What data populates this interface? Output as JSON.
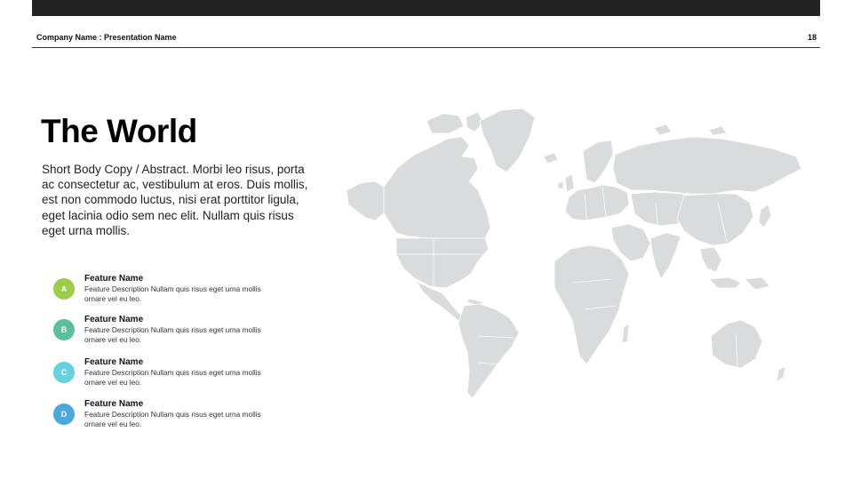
{
  "header": {
    "company_presentation": "Company Name : Presentation Name",
    "page_number": "18"
  },
  "slide": {
    "title": "The World",
    "body": "Short Body Copy / Abstract.  Morbi leo risus, porta ac consectetur ac, vestibulum at eros. Duis mollis, est non commodo luctus, nisi erat porttitor ligula, eget lacinia odio sem nec elit. Nullam quis risus eget urna mollis."
  },
  "features": [
    {
      "letter": "A",
      "name": "Feature Name",
      "description": "Feature Description Nullam quis risus eget urna mollis ornare vel eu leo.",
      "color": "#9ccc4a"
    },
    {
      "letter": "B",
      "name": "Feature Name",
      "description": "Feature Description Nullam quis risus eget urna mollis ornare vel eu leo.",
      "color": "#5cbf9a"
    },
    {
      "letter": "C",
      "name": "Feature Name",
      "description": "Feature Description Nullam quis risus eget urna mollis ornare vel eu leo.",
      "color": "#66d2e0"
    },
    {
      "letter": "D",
      "name": "Feature Name",
      "description": "Feature Description Nullam quis risus eget urna mollis ornare vel eu leo.",
      "color": "#4aa8dc"
    }
  ],
  "colors": {
    "top_bar": "#222222",
    "map_land": "#d9dbdc"
  },
  "map": {
    "icon": "world-map"
  }
}
